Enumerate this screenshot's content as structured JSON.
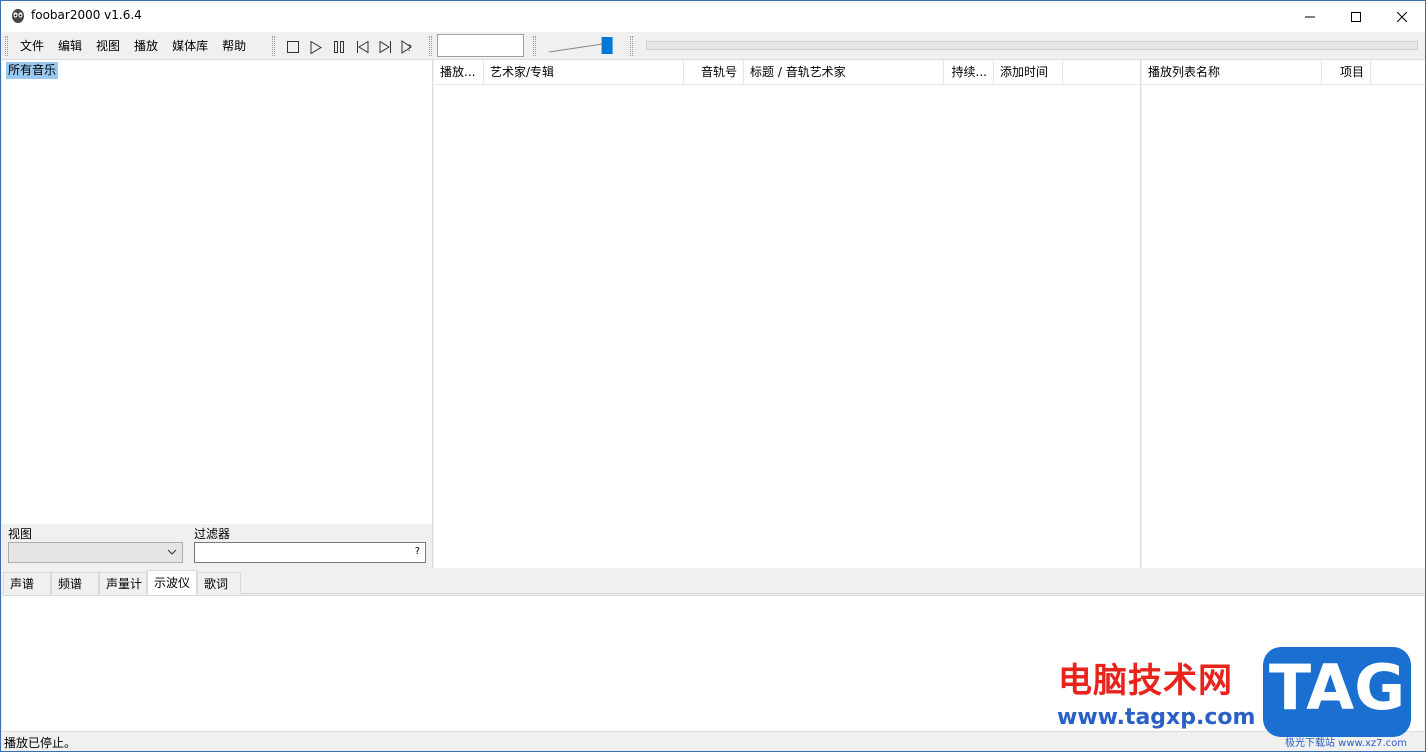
{
  "window": {
    "title": "foobar2000 v1.6.4"
  },
  "menu": {
    "items": [
      "文件",
      "编辑",
      "视图",
      "播放",
      "媒体库",
      "帮助"
    ]
  },
  "toolbar": {
    "buttons": [
      "stop-icon",
      "play-icon",
      "pause-icon",
      "previous-icon",
      "next-icon",
      "random-icon"
    ],
    "volume_level": 0.9,
    "seek_position": 0
  },
  "library": {
    "tree_root": "所有音乐",
    "view_label": "视图",
    "view_value": "",
    "filter_label": "过滤器",
    "filter_value": "",
    "filter_help": "?"
  },
  "playlist": {
    "columns": [
      "播放...",
      "艺术家/专辑",
      "音轨号",
      "标题 / 音轨艺术家",
      "持续...",
      "添加时间"
    ],
    "rows": []
  },
  "playlist_manager": {
    "columns": [
      "播放列表名称",
      "项目"
    ],
    "rows": []
  },
  "visualization": {
    "tabs": [
      "声谱",
      "频谱",
      "声量计",
      "示波仪",
      "歌词"
    ],
    "active_tab": "示波仪"
  },
  "status": {
    "text": "播放已停止。"
  },
  "watermark": {
    "brand_cn": "电脑技术网",
    "url": "www.tagxp.com",
    "badge": "TAG",
    "badge_sub": "极光下载站 www.xz7.com"
  },
  "colors": {
    "selection": "#99c9ef",
    "volume_thumb": "#0078d7",
    "watermark_red": "#e8231c",
    "watermark_blue": "#1a6fd1"
  }
}
